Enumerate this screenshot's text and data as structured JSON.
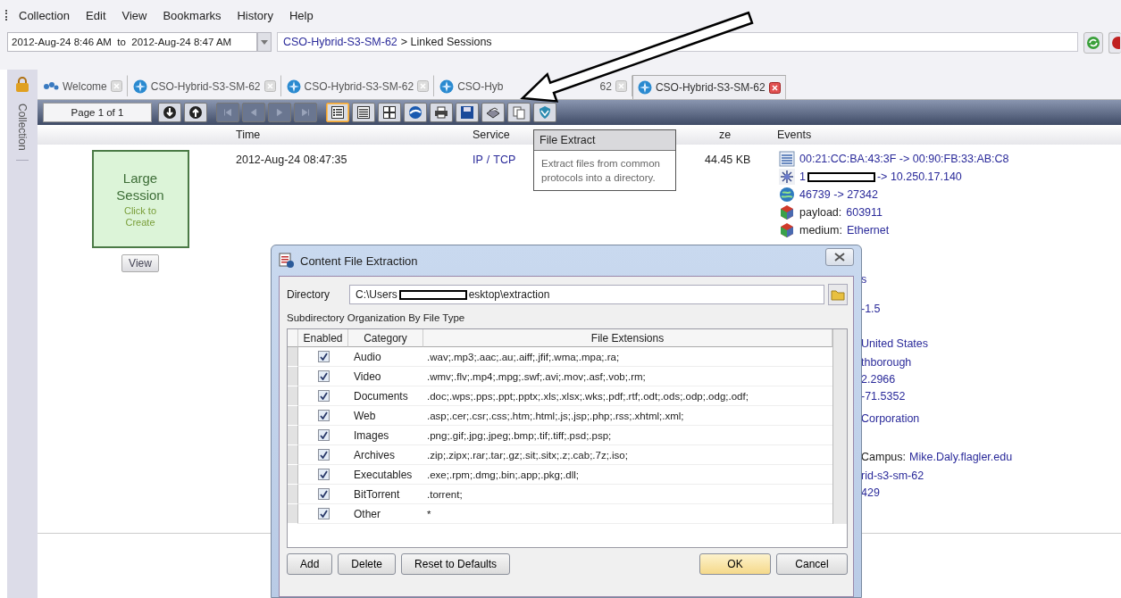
{
  "menu": [
    "Collection",
    "Edit",
    "View",
    "Bookmarks",
    "History",
    "Help"
  ],
  "time_range": {
    "value": "2012-Aug-24 8:46 AM  to  2012-Aug-24 8:47 AM"
  },
  "breadcrumb": {
    "link": "CSO-Hybrid-S3-SM-62",
    "rest": "> Linked Sessions"
  },
  "sidebar": {
    "label": "Collection"
  },
  "tabs": [
    {
      "kind": "welcome",
      "label": "Welcome",
      "selected": false
    },
    {
      "kind": "session",
      "label": "CSO-Hybrid-S3-SM-62",
      "selected": false
    },
    {
      "kind": "session",
      "label": "CSO-Hybrid-S3-SM-62",
      "selected": false
    },
    {
      "kind": "session",
      "label": "CSO-Hyb",
      "label_end": "62",
      "selected": false
    },
    {
      "kind": "session",
      "label": "CSO-Hybrid-S3-SM-62",
      "selected": true
    }
  ],
  "toolbar": {
    "page": "Page 1 of 1",
    "nav_disabled": true,
    "view_modes": [
      {
        "selected": true
      },
      {
        "selected": false
      },
      {
        "selected": false
      }
    ]
  },
  "columns": [
    "Time",
    "Service",
    "ze",
    "Events"
  ],
  "session": {
    "card_title": "Large Session",
    "card_hint": "Click to Create",
    "view_button": "View",
    "time": "2012-Aug-24 08:47:35",
    "service": [
      {
        "text": "IP"
      },
      {
        "text": "/"
      },
      {
        "text": "TCP"
      }
    ],
    "size": "44.45 KB"
  },
  "events": [
    {
      "kind": "ethernet",
      "value": "00:21:CC:BA:43:3F -> 00:90:FB:33:AB:C8"
    },
    {
      "kind": "ip",
      "value": "1",
      "redacted": true,
      "value_after": "-> 10.250.17.140"
    },
    {
      "kind": "port",
      "value": "46739 -> 27342"
    },
    {
      "kind": "payload",
      "label": "payload:",
      "value": "603911"
    },
    {
      "kind": "payload",
      "label": "medium:",
      "value": "Ethernet"
    }
  ],
  "events_partly_hidden": [
    {
      "value": "s"
    },
    {
      "value": "-1.5"
    },
    {
      "value": "United States"
    },
    {
      "value": "thborough"
    },
    {
      "value": "2.2966"
    },
    {
      "value": "-71.5352"
    },
    {
      "value": "Corporation"
    },
    {
      "label": "Campus:",
      "value": "Mike.Daly.flagler.edu"
    },
    {
      "value": "rid-s3-sm-62"
    },
    {
      "value": "429"
    }
  ],
  "tooltip": {
    "title": "File Extract",
    "text": "Extract files from common protocols into a directory."
  },
  "dialog": {
    "title": "Content File Extraction",
    "directory_label": "Directory",
    "directory": {
      "value": "C:\\Users",
      "redacted": true,
      "value_after": "esktop\\extraction"
    },
    "section": "Subdirectory Organization By File Type",
    "columns": [
      "Enabled",
      "Category",
      "File Extensions"
    ],
    "rows": [
      {
        "checked": true,
        "category": "Audio",
        "extensions": ".wav;.mp3;.aac;.au;.aiff;.jfif;.wma;.mpa;.ra;"
      },
      {
        "checked": true,
        "category": "Video",
        "extensions": ".wmv;.flv;.mp4;.mpg;.swf;.avi;.mov;.asf;.vob;.rm;"
      },
      {
        "checked": true,
        "category": "Documents",
        "extensions": ".doc;.wps;.pps;.ppt;.pptx;.xls;.xlsx;.wks;.pdf;.rtf;.odt;.ods;.odp;.odg;.odf;"
      },
      {
        "checked": true,
        "category": "Web",
        "extensions": ".asp;.cer;.csr;.css;.htm;.html;.js;.jsp;.php;.rss;.xhtml;.xml;"
      },
      {
        "checked": true,
        "category": "Images",
        "extensions": ".png;.gif;.jpg;.jpeg;.bmp;.tif;.tiff;.psd;.psp;"
      },
      {
        "checked": true,
        "category": "Archives",
        "extensions": ".zip;.zipx;.rar;.tar;.gz;.sit;.sitx;.z;.cab;.7z;.iso;"
      },
      {
        "checked": true,
        "category": "Executables",
        "extensions": ".exe;.rpm;.dmg;.bin;.app;.pkg;.dll;"
      },
      {
        "checked": true,
        "category": "BitTorrent",
        "extensions": ".torrent;"
      },
      {
        "checked": true,
        "category": "Other",
        "extensions": "*"
      }
    ],
    "buttons_left": [
      "Add",
      "Delete",
      "Reset to Defaults"
    ],
    "buttons_right": [
      "OK",
      "Cancel"
    ]
  }
}
